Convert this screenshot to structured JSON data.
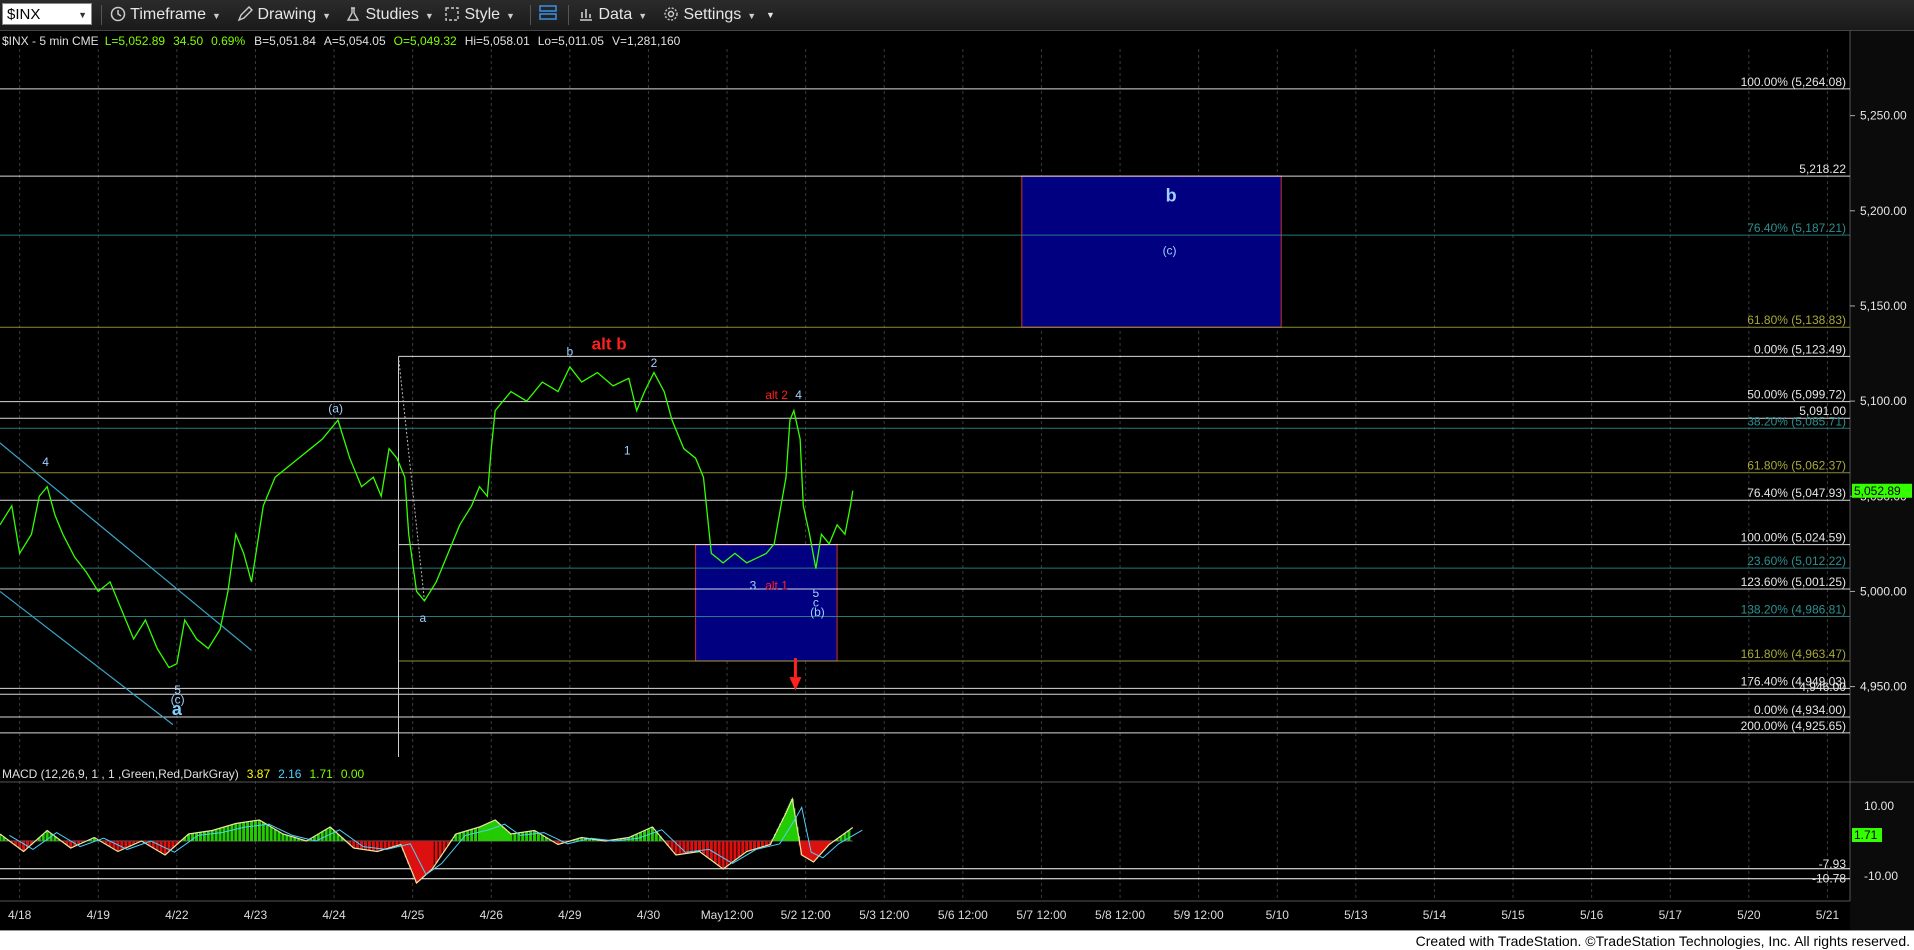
{
  "toolbar": {
    "symbol": "$INX",
    "timeframe": "Timeframe",
    "drawing": "Drawing",
    "studies": "Studies",
    "style": "Style",
    "data": "Data",
    "settings": "Settings"
  },
  "footer": "Created with TradeStation. ©TradeStation Technologies, Inc. All rights reserved.",
  "chart_data": {
    "type": "line",
    "header": {
      "title": "$INX - 5 min  CME",
      "last": "L=5,052.89",
      "change": "34.50",
      "pct": "0.69%",
      "bid": "B=5,051.84",
      "ask": "A=5,054.05",
      "open": "O=5,049.32",
      "high": "Hi=5,058.01",
      "low": "Lo=5,011.05",
      "volume": "V=1,281,160"
    },
    "price_axis": {
      "ticks": [
        "5,250.00",
        "5,200.00",
        "5,150.00",
        "5,100.00",
        "5,050.00",
        "5,000.00",
        "4,950.00"
      ],
      "tick_values": [
        5250,
        5200,
        5150,
        5100,
        5050,
        5000,
        4950
      ],
      "range": [
        4913,
        5295
      ],
      "last_price": "5,052.89"
    },
    "time_axis": [
      "4/18",
      "4/19",
      "4/22",
      "4/23",
      "4/24",
      "4/25",
      "4/26",
      "4/29",
      "4/30",
      "May12:00",
      "5/2 12:00",
      "5/3 12:00",
      "5/6 12:00",
      "5/7 12:00",
      "5/8 12:00",
      "5/9 12:00",
      "5/10",
      "5/13",
      "5/14",
      "5/15",
      "5/16",
      "5/17",
      "5/20",
      "5/21"
    ],
    "levels": [
      {
        "label": "100.00% (5,264.08)",
        "value": 5264.08,
        "color": "#ffffff",
        "span": "full"
      },
      {
        "label": "5,218.22",
        "value": 5218.22,
        "color": "#ffffff",
        "span": "full"
      },
      {
        "label": "76.40% (5,187.21)",
        "value": 5187.21,
        "color": "#2f8f8f",
        "span": "full"
      },
      {
        "label": "61.80% (5,138.83)",
        "value": 5138.83,
        "color": "#a8a83a",
        "span": "full"
      },
      {
        "label": "0.00% (5,123.49)",
        "value": 5123.49,
        "color": "#ffffff",
        "span": "mid"
      },
      {
        "label": "50.00% (5,099.72)",
        "value": 5099.72,
        "color": "#ffffff",
        "span": "full"
      },
      {
        "label": "5,091.00",
        "value": 5091.0,
        "color": "#ffffff",
        "span": "full"
      },
      {
        "label": "38.20% (5,085.71)",
        "value": 5085.71,
        "color": "#2f8f8f",
        "span": "full"
      },
      {
        "label": "61.80% (5,062.37)",
        "value": 5062.37,
        "color": "#a8a83a",
        "span": "full"
      },
      {
        "label": "76.40% (5,047.93)",
        "value": 5047.93,
        "color": "#ffffff",
        "span": "full"
      },
      {
        "label": "100.00% (5,024.59)",
        "value": 5024.59,
        "color": "#ffffff",
        "span": "mid"
      },
      {
        "label": "23.60% (5,012.22)",
        "value": 5012.22,
        "color": "#2f8f8f",
        "span": "full"
      },
      {
        "label": "123.60% (5,001.25)",
        "value": 5001.25,
        "color": "#ffffff",
        "span": "full"
      },
      {
        "label": "138.20% (4,986.81)",
        "value": 4986.81,
        "color": "#2f8f8f",
        "span": "full"
      },
      {
        "label": "161.80% (4,963.47)",
        "value": 4963.47,
        "color": "#a8a83a",
        "span": "mid"
      },
      {
        "label": "176.40% (4,949.03)",
        "value": 4949.03,
        "color": "#ffffff",
        "span": "full"
      },
      {
        "label": "4,946.00",
        "value": 4946.0,
        "color": "#ffffff",
        "span": "full"
      },
      {
        "label": "0.00% (4,934.00)",
        "value": 4934.0,
        "color": "#ffffff",
        "span": "full"
      },
      {
        "label": "200.00% (4,925.65)",
        "value": 4925.65,
        "color": "#ffffff",
        "span": "full"
      }
    ],
    "boxes": [
      {
        "name": "target-b",
        "top": 5218.22,
        "bottom": 5138.83,
        "t0": 13.0,
        "t1": 16.3
      },
      {
        "name": "support",
        "top": 5024.59,
        "bottom": 4963.47,
        "t0": 8.85,
        "t1": 10.65
      }
    ],
    "wave_labels": [
      {
        "text": "b",
        "t": 14.9,
        "p": 5205,
        "color": "#9fd0ff",
        "size": 18,
        "bold": true
      },
      {
        "text": "(c)",
        "t": 14.88,
        "p": 5177,
        "color": "#9fd0ff",
        "size": 12,
        "bold": false
      },
      {
        "text": "alt b",
        "t": 7.75,
        "p": 5127,
        "color": "#ff2020",
        "size": 17,
        "bold": true
      },
      {
        "text": "b",
        "t": 7.25,
        "p": 5124,
        "color": "#9fd0ff",
        "size": 12,
        "bold": false
      },
      {
        "text": "2",
        "t": 8.32,
        "p": 5118,
        "color": "#9fd0ff",
        "size": 12,
        "bold": false
      },
      {
        "text": "alt 2",
        "t": 9.88,
        "p": 5101,
        "color": "#ff2020",
        "size": 12,
        "bold": false
      },
      {
        "text": "4",
        "t": 10.16,
        "p": 5101,
        "color": "#9fd0ff",
        "size": 12,
        "bold": false
      },
      {
        "text": "(a)",
        "t": 4.27,
        "p": 5094,
        "color": "#9fd0ff",
        "size": 12,
        "bold": false
      },
      {
        "text": "1",
        "t": 7.98,
        "p": 5072,
        "color": "#9fd0ff",
        "size": 12,
        "bold": false
      },
      {
        "text": "4",
        "t": 0.58,
        "p": 5066,
        "color": "#9fd0ff",
        "size": 12,
        "bold": false
      },
      {
        "text": "3",
        "t": 9.58,
        "p": 5001,
        "color": "#9fd0ff",
        "size": 12,
        "bold": false
      },
      {
        "text": "alt 1",
        "t": 9.88,
        "p": 5001,
        "color": "#ff2020",
        "size": 12,
        "bold": false
      },
      {
        "text": "5",
        "t": 10.38,
        "p": 4997,
        "color": "#9fd0ff",
        "size": 12,
        "bold": false
      },
      {
        "text": "c",
        "t": 10.38,
        "p": 4992,
        "color": "#9fd0ff",
        "size": 12,
        "bold": false
      },
      {
        "text": "(b)",
        "t": 10.4,
        "p": 4987,
        "color": "#9fd0ff",
        "size": 12,
        "bold": false
      },
      {
        "text": "a",
        "t": 5.38,
        "p": 4984,
        "color": "#9fd0ff",
        "size": 12,
        "bold": false
      },
      {
        "text": "5",
        "t": 2.26,
        "p": 4946,
        "color": "#9fd0ff",
        "size": 12,
        "bold": false
      },
      {
        "text": "(c)",
        "t": 2.26,
        "p": 4941,
        "color": "#9fd0ff",
        "size": 12,
        "bold": false
      },
      {
        "text": "a",
        "t": 2.25,
        "p": 4935,
        "color": "#7fd0ff",
        "size": 18,
        "bold": true
      }
    ],
    "price_path": [
      [
        0.0,
        5035
      ],
      [
        0.15,
        5045
      ],
      [
        0.25,
        5020
      ],
      [
        0.4,
        5030
      ],
      [
        0.5,
        5050
      ],
      [
        0.6,
        5055
      ],
      [
        0.7,
        5040
      ],
      [
        0.8,
        5030
      ],
      [
        0.95,
        5018
      ],
      [
        1.1,
        5010
      ],
      [
        1.25,
        5000
      ],
      [
        1.4,
        5005
      ],
      [
        1.55,
        4990
      ],
      [
        1.7,
        4975
      ],
      [
        1.85,
        4985
      ],
      [
        2.0,
        4970
      ],
      [
        2.15,
        4960
      ],
      [
        2.25,
        4962
      ],
      [
        2.35,
        4985
      ],
      [
        2.5,
        4975
      ],
      [
        2.65,
        4970
      ],
      [
        2.8,
        4980
      ],
      [
        2.9,
        5000
      ],
      [
        3.0,
        5030
      ],
      [
        3.1,
        5020
      ],
      [
        3.2,
        5005
      ],
      [
        3.35,
        5045
      ],
      [
        3.5,
        5060
      ],
      [
        3.65,
        5065
      ],
      [
        3.8,
        5070
      ],
      [
        3.95,
        5075
      ],
      [
        4.1,
        5080
      ],
      [
        4.3,
        5090
      ],
      [
        4.45,
        5070
      ],
      [
        4.6,
        5055
      ],
      [
        4.75,
        5060
      ],
      [
        4.85,
        5050
      ],
      [
        4.95,
        5075
      ],
      [
        5.05,
        5070
      ],
      [
        5.15,
        5060
      ],
      [
        5.2,
        5030
      ],
      [
        5.3,
        5000
      ],
      [
        5.4,
        4995
      ],
      [
        5.55,
        5005
      ],
      [
        5.7,
        5020
      ],
      [
        5.85,
        5035
      ],
      [
        6.0,
        5045
      ],
      [
        6.1,
        5055
      ],
      [
        6.2,
        5050
      ],
      [
        6.25,
        5075
      ],
      [
        6.3,
        5095
      ],
      [
        6.5,
        5105
      ],
      [
        6.7,
        5100
      ],
      [
        6.9,
        5110
      ],
      [
        7.1,
        5105
      ],
      [
        7.25,
        5118
      ],
      [
        7.4,
        5110
      ],
      [
        7.6,
        5115
      ],
      [
        7.8,
        5108
      ],
      [
        8.0,
        5112
      ],
      [
        8.1,
        5095
      ],
      [
        8.2,
        5105
      ],
      [
        8.32,
        5115
      ],
      [
        8.45,
        5105
      ],
      [
        8.55,
        5090
      ],
      [
        8.7,
        5075
      ],
      [
        8.85,
        5070
      ],
      [
        8.95,
        5060
      ],
      [
        9.05,
        5020
      ],
      [
        9.2,
        5015
      ],
      [
        9.35,
        5020
      ],
      [
        9.5,
        5015
      ],
      [
        9.65,
        5018
      ],
      [
        9.75,
        5020
      ],
      [
        9.85,
        5025
      ],
      [
        10.0,
        5060
      ],
      [
        10.05,
        5090
      ],
      [
        10.1,
        5095
      ],
      [
        10.18,
        5080
      ],
      [
        10.22,
        5045
      ],
      [
        10.3,
        5030
      ],
      [
        10.38,
        5012
      ],
      [
        10.45,
        5030
      ],
      [
        10.55,
        5025
      ],
      [
        10.65,
        5035
      ],
      [
        10.75,
        5030
      ],
      [
        10.82,
        5045
      ],
      [
        10.85,
        5052.89
      ]
    ],
    "macd": {
      "label": "MACD (12,26,9, 1 , 1 ,Green,Red,DarkGray)",
      "macd": "3.87",
      "signal": "2.16",
      "diff": "1.71",
      "zero": "0.00",
      "axis_ticks": [
        "10.00",
        "-10.00"
      ],
      "tick_values": [
        10,
        -10
      ],
      "levels": [
        "-7.93",
        "-10.78"
      ],
      "level_values": [
        -7.93,
        -10.78
      ],
      "range": [
        -14,
        14
      ],
      "last_diff_label": "1.71",
      "series": [
        [
          0.0,
          2
        ],
        [
          0.3,
          -3
        ],
        [
          0.6,
          3
        ],
        [
          0.9,
          -2
        ],
        [
          1.2,
          1
        ],
        [
          1.5,
          -3
        ],
        [
          1.8,
          0
        ],
        [
          2.1,
          -4
        ],
        [
          2.4,
          2
        ],
        [
          2.7,
          3
        ],
        [
          3.0,
          5
        ],
        [
          3.3,
          6
        ],
        [
          3.6,
          2
        ],
        [
          3.9,
          0
        ],
        [
          4.2,
          4
        ],
        [
          4.5,
          -2
        ],
        [
          4.8,
          -3
        ],
        [
          5.1,
          -1
        ],
        [
          5.3,
          -12
        ],
        [
          5.5,
          -8
        ],
        [
          5.8,
          2
        ],
        [
          6.1,
          4
        ],
        [
          6.3,
          6
        ],
        [
          6.5,
          2
        ],
        [
          6.8,
          3
        ],
        [
          7.1,
          -1
        ],
        [
          7.4,
          1
        ],
        [
          7.7,
          0
        ],
        [
          8.0,
          1
        ],
        [
          8.3,
          4
        ],
        [
          8.6,
          -4
        ],
        [
          8.9,
          -3
        ],
        [
          9.2,
          -8
        ],
        [
          9.5,
          -3
        ],
        [
          9.8,
          -1
        ],
        [
          10.0,
          8
        ],
        [
          10.08,
          12
        ],
        [
          10.2,
          -4
        ],
        [
          10.35,
          -6
        ],
        [
          10.55,
          -1
        ],
        [
          10.85,
          3.87
        ]
      ]
    }
  }
}
